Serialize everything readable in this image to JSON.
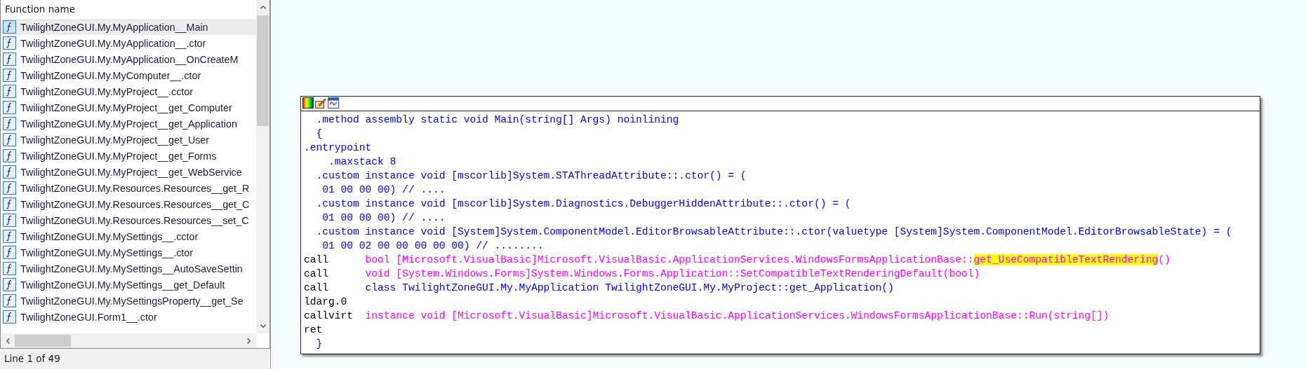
{
  "function_list": {
    "column_header": "Function name",
    "rows": [
      {
        "name": "TwilightZoneGUI.My.MyApplication__Main",
        "selected": true
      },
      {
        "name": "TwilightZoneGUI.My.MyApplication__.ctor",
        "selected": false
      },
      {
        "name": "TwilightZoneGUI.My.MyApplication__OnCreateM",
        "selected": false
      },
      {
        "name": "TwilightZoneGUI.My.MyComputer__.ctor",
        "selected": false
      },
      {
        "name": "TwilightZoneGUI.My.MyProject__.cctor",
        "selected": false
      },
      {
        "name": "TwilightZoneGUI.My.MyProject__get_Computer",
        "selected": false
      },
      {
        "name": "TwilightZoneGUI.My.MyProject__get_Application",
        "selected": false
      },
      {
        "name": "TwilightZoneGUI.My.MyProject__get_User",
        "selected": false
      },
      {
        "name": "TwilightZoneGUI.My.MyProject__get_Forms",
        "selected": false
      },
      {
        "name": "TwilightZoneGUI.My.MyProject__get_WebService",
        "selected": false
      },
      {
        "name": "TwilightZoneGUI.My.Resources.Resources__get_R",
        "selected": false
      },
      {
        "name": "TwilightZoneGUI.My.Resources.Resources__get_C",
        "selected": false
      },
      {
        "name": "TwilightZoneGUI.My.Resources.Resources__set_C",
        "selected": false
      },
      {
        "name": "TwilightZoneGUI.My.MySettings__.cctor",
        "selected": false
      },
      {
        "name": "TwilightZoneGUI.My.MySettings__.ctor",
        "selected": false
      },
      {
        "name": "TwilightZoneGUI.My.MySettings__AutoSaveSettin",
        "selected": false
      },
      {
        "name": "TwilightZoneGUI.My.MySettings__get_Default",
        "selected": false
      },
      {
        "name": "TwilightZoneGUI.My.MySettingsProperty__get_Se",
        "selected": false
      },
      {
        "name": "TwilightZoneGUI.Form1__.ctor",
        "selected": false
      }
    ]
  },
  "status_bar": "Line 1 of 49",
  "code_view": {
    "lines": [
      {
        "kind": "directive",
        "text": "  .method assembly static void Main(string[] Args) noinlining"
      },
      {
        "kind": "directive",
        "text": "  {"
      },
      {
        "kind": "directive",
        "text": ".entrypoint"
      },
      {
        "kind": "directive",
        "text": "    .maxstack 8"
      },
      {
        "kind": "directive",
        "text": "  .custom instance void [mscorlib]System.STAThreadAttribute::.ctor() = ("
      },
      {
        "kind": "directive",
        "text": "   01 00 00 00) // ...."
      },
      {
        "kind": "directive",
        "text": "  .custom instance void [mscorlib]System.Diagnostics.DebuggerHiddenAttribute::.ctor() = ("
      },
      {
        "kind": "directive",
        "text": "   01 00 00 00) // ...."
      },
      {
        "kind": "directive",
        "text": "  .custom instance void [System]System.ComponentModel.EditorBrowsableAttribute::.ctor(valuetype [System]System.ComponentModel.EditorBrowsableState) = ("
      },
      {
        "kind": "directive",
        "text": "   01 00 02 00 00 00 00 00) // ........"
      },
      {
        "kind": "instruction",
        "opcode": "call",
        "color": "#ff00ff",
        "operand": [
          {
            "text": "bool [Microsoft.VisualBasic]Microsoft.VisualBasic.ApplicationServices.WindowsFormsApplicationBase::",
            "highlighted": false
          },
          {
            "text": "get_UseCompatibleTextRendering",
            "highlighted": true
          },
          {
            "text": "()",
            "highlighted": false
          }
        ]
      },
      {
        "kind": "instruction",
        "opcode": "call",
        "color": "#ff00ff",
        "operand": [
          {
            "text": "void [System.Windows.Forms]System.Windows.Forms.Application::SetCompatibleTextRenderingDefault(bool)",
            "highlighted": false
          }
        ]
      },
      {
        "kind": "instruction",
        "opcode": "call",
        "color": "#0000ff",
        "operand": [
          {
            "text": "class TwilightZoneGUI.My.MyApplication TwilightZoneGUI.My.MyProject::get_Application()",
            "highlighted": false
          }
        ]
      },
      {
        "kind": "instruction",
        "opcode": "ldarg.0"
      },
      {
        "kind": "instruction",
        "opcode": "callvirt",
        "color": "#ff00ff",
        "operand": [
          {
            "text": "instance void [Microsoft.VisualBasic]Microsoft.VisualBasic.ApplicationServices.WindowsFormsApplicationBase::Run(string[])",
            "highlighted": false
          }
        ]
      },
      {
        "kind": "instruction",
        "opcode": "ret"
      },
      {
        "kind": "directive",
        "text": "  }"
      }
    ]
  }
}
